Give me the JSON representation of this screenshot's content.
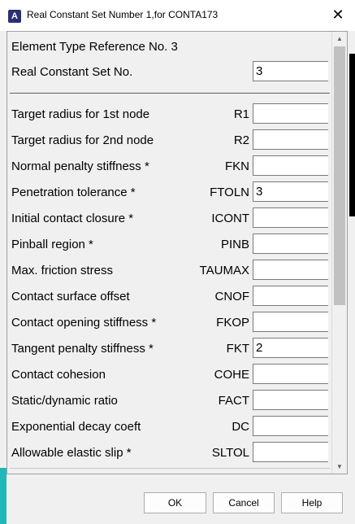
{
  "window": {
    "title": "Real Constant Set Number 1,for CONTA173",
    "app_icon_letter": "A"
  },
  "header": {
    "element_type_ref": "Element Type Reference No. 3",
    "real_const_label": "Real Constant Set No.",
    "real_const_value": "3"
  },
  "rows": [
    {
      "label": "Target radius for 1st node",
      "code": "R1",
      "value": ""
    },
    {
      "label": "Target radius for 2nd node",
      "code": "R2",
      "value": ""
    },
    {
      "label": "Normal penalty stiffness *",
      "code": "FKN",
      "value": ""
    },
    {
      "label": "Penetration tolerance *",
      "code": "FTOLN",
      "value": "3"
    },
    {
      "label": "Initial contact closure *",
      "code": "ICONT",
      "value": ""
    },
    {
      "label": "Pinball region *",
      "code": "PINB",
      "value": ""
    },
    {
      "label": "Max. friction stress",
      "code": "TAUMAX",
      "value": ""
    },
    {
      "label": "Contact surface offset",
      "code": "CNOF",
      "value": ""
    },
    {
      "label": "Contact opening stiffness *",
      "code": "FKOP",
      "value": ""
    },
    {
      "label": "Tangent penalty stiffness *",
      "code": "FKT",
      "value": "2"
    },
    {
      "label": "Contact cohesion",
      "code": "COHE",
      "value": ""
    },
    {
      "label": "Static/dynamic ratio",
      "code": "FACT",
      "value": ""
    },
    {
      "label": "Exponential decay coeft",
      "code": "DC",
      "value": ""
    },
    {
      "label": "Allowable elastic slip *",
      "code": "SLTOL",
      "value": ""
    }
  ],
  "buttons": {
    "ok": "OK",
    "cancel": "Cancel",
    "help": "Help"
  },
  "icons": {
    "close": "close-icon",
    "scroll_up": "arrow-up-icon",
    "scroll_down": "arrow-down-icon"
  }
}
